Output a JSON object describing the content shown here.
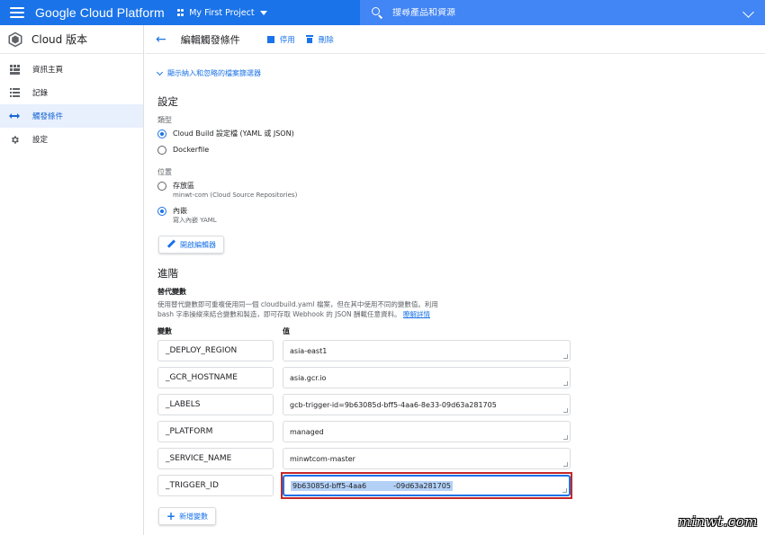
{
  "topbar": {
    "brand": "Google Cloud Platform",
    "project": "My First Project",
    "search_placeholder": "搜尋產品和資源"
  },
  "sidebar": {
    "title": "Cloud 版本",
    "items": [
      {
        "label": "資訊主頁",
        "icon": "dashboard-icon"
      },
      {
        "label": "記錄",
        "icon": "list-icon"
      },
      {
        "label": "觸發條件",
        "icon": "trigger-arrows-icon",
        "active": true
      },
      {
        "label": "設定",
        "icon": "gear-icon"
      }
    ]
  },
  "header": {
    "title": "編輯觸發條件",
    "disable_label": "停用",
    "delete_label": "刪除"
  },
  "main": {
    "filter_link": "顯示納入和忽略的檔案篩選器",
    "settings_title": "設定",
    "type_label": "類型",
    "type_options": [
      {
        "label": "Cloud Build 設定檔 (YAML 或 JSON)",
        "selected": true
      },
      {
        "label": "Dockerfile",
        "selected": false
      }
    ],
    "location_label": "位置",
    "location_options": [
      {
        "label": "存放區",
        "sub": "minwt-com (Cloud Source Repositories)",
        "selected": false
      },
      {
        "label": "內嵌",
        "sub": "寫入內嵌 YAML",
        "selected": true
      }
    ],
    "open_editor_label": "開啟編輯器",
    "advanced_title": "進階",
    "subst_title": "替代變數",
    "subst_desc_1": "使用替代變數即可重複使用同一個 cloudbuild.yaml 檔案，但在其中使用不同的變數值。利用",
    "subst_desc_2": "bash 字串操縱來結合變數和製造，即可存取 Webhook 的 JSON 酬載任意資料。",
    "learn_more": "瞭解詳情",
    "col_variable": "變數",
    "col_value": "值",
    "variables": [
      {
        "name": "_DEPLOY_REGION",
        "value": "asia-east1"
      },
      {
        "name": "_GCR_HOSTNAME",
        "value": "asia.gcr.io"
      },
      {
        "name": "_LABELS",
        "value": "gcb-trigger-id=9b63085d-bff5-4aa6-8e33-09d63a281705"
      },
      {
        "name": "_PLATFORM",
        "value": "managed"
      },
      {
        "name": "_SERVICE_NAME",
        "value": "minwtcom-master"
      }
    ],
    "trigger_var": {
      "name": "_TRIGGER_ID",
      "value_part1": "9b63085d-bff5-4aa6",
      "value_part2": "-09d63a281705"
    },
    "add_variable_label": "新增變數"
  },
  "watermark": "minwt.com",
  "colors": {
    "primary": "#1a73e8",
    "highlight_border": "#c62828",
    "active_bg": "#e8f0fe"
  }
}
